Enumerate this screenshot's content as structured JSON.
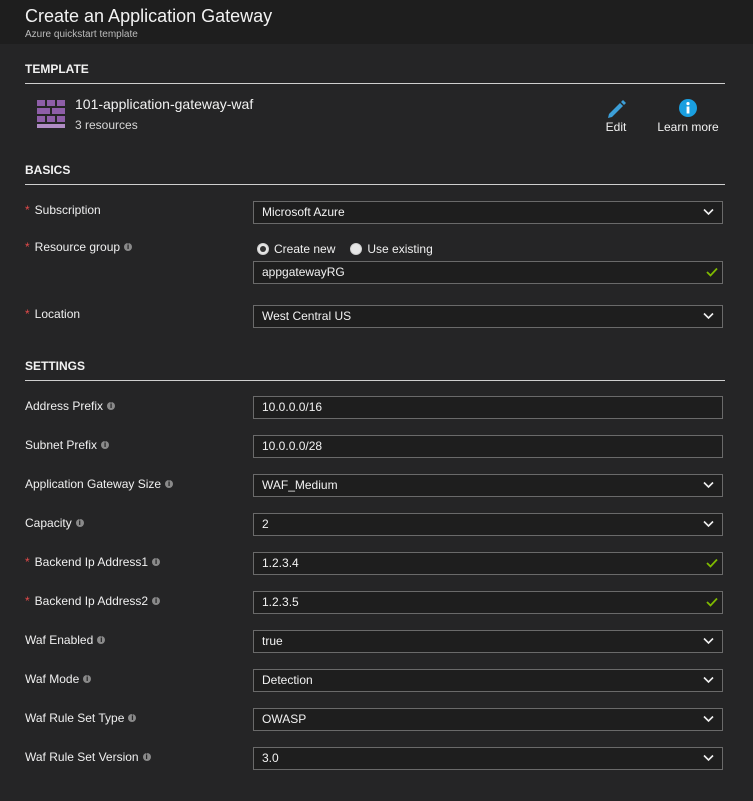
{
  "header": {
    "title": "Create an Application Gateway",
    "subtitle": "Azure quickstart template"
  },
  "template": {
    "section_title": "TEMPLATE",
    "name": "101-application-gateway-waf",
    "resources": "3 resources",
    "icon": "template-grid-icon",
    "edit_label": "Edit",
    "learn_more_label": "Learn more"
  },
  "basics": {
    "section_title": "BASICS",
    "subscription": {
      "label": "Subscription",
      "value": "Microsoft Azure"
    },
    "resource_group": {
      "label": "Resource group",
      "option_new": "Create new",
      "option_existing": "Use existing",
      "selected": "Create new",
      "value": "appgatewayRG"
    },
    "location": {
      "label": "Location",
      "value": "West Central US"
    }
  },
  "settings": {
    "section_title": "SETTINGS",
    "address_prefix": {
      "label": "Address Prefix",
      "value": "10.0.0.0/16"
    },
    "subnet_prefix": {
      "label": "Subnet Prefix",
      "value": "10.0.0.0/28"
    },
    "gateway_size": {
      "label": "Application Gateway Size",
      "value": "WAF_Medium"
    },
    "capacity": {
      "label": "Capacity",
      "value": "2"
    },
    "backend_ip1": {
      "label": "Backend Ip Address1",
      "value": "1.2.3.4"
    },
    "backend_ip2": {
      "label": "Backend Ip Address2",
      "value": "1.2.3.5"
    },
    "waf_enabled": {
      "label": "Waf Enabled",
      "value": "true"
    },
    "waf_mode": {
      "label": "Waf Mode",
      "value": "Detection"
    },
    "waf_rule_set_type": {
      "label": "Waf Rule Set Type",
      "value": "OWASP"
    },
    "waf_rule_set_version": {
      "label": "Waf Rule Set Version",
      "value": "3.0"
    }
  },
  "colors": {
    "background": "#252526",
    "required": "#e24a4a",
    "valid_check": "#7fba00",
    "edit_icon": "#3c9fd8",
    "info_icon": "#1a9fe0",
    "template_icon": "#8e5ea8"
  }
}
